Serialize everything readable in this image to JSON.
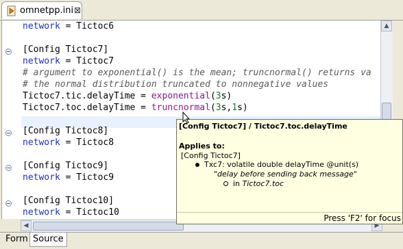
{
  "tab": {
    "filename": "omnetpp.ini",
    "close_glyph": "⊠",
    "icon": "ini-file-icon"
  },
  "editor": {
    "lines": [
      {
        "parts": [
          {
            "t": "network",
            "c": "kw"
          },
          {
            "t": " = Tictoc6",
            "c": ""
          }
        ]
      },
      {
        "parts": [
          {
            "t": "[Config Tictoc7]",
            "c": ""
          }
        ]
      },
      {
        "parts": [
          {
            "t": "network",
            "c": "kw"
          },
          {
            "t": " = Tictoc7",
            "c": ""
          }
        ]
      },
      {
        "parts": [
          {
            "t": "# argument to exponential() is the mean; truncnormal() returns va",
            "c": "cm"
          }
        ]
      },
      {
        "parts": [
          {
            "t": "# the normal distribution truncated to nonnegative values",
            "c": "cm"
          }
        ]
      },
      {
        "parts": [
          {
            "t": "Tictoc7.tic.delayTime = ",
            "c": ""
          },
          {
            "t": "exponential",
            "c": "fn"
          },
          {
            "t": "(",
            "c": ""
          },
          {
            "t": "3",
            "c": "num"
          },
          {
            "t": "s)",
            "c": ""
          }
        ]
      },
      {
        "parts": [
          {
            "t": "Tictoc7.toc.delayTime = ",
            "c": ""
          },
          {
            "t": "truncnormal",
            "c": "fn"
          },
          {
            "t": "(",
            "c": ""
          },
          {
            "t": "3",
            "c": "num"
          },
          {
            "t": "s,",
            "c": ""
          },
          {
            "t": "1",
            "c": "num"
          },
          {
            "t": "s)",
            "c": ""
          }
        ]
      },
      {
        "parts": []
      },
      {
        "parts": [
          {
            "t": "[Config Tictoc8]",
            "c": ""
          }
        ]
      },
      {
        "parts": [
          {
            "t": "network",
            "c": "kw"
          },
          {
            "t": " = Tictoc8",
            "c": ""
          }
        ]
      },
      {
        "parts": []
      },
      {
        "parts": [
          {
            "t": "[Config Tictoc9]",
            "c": ""
          }
        ]
      },
      {
        "parts": [
          {
            "t": "network",
            "c": "kw"
          },
          {
            "t": " = Tictoc9",
            "c": ""
          }
        ]
      },
      {
        "parts": []
      },
      {
        "parts": [
          {
            "t": "[Config Tictoc10]",
            "c": ""
          }
        ]
      },
      {
        "parts": [
          {
            "t": "network",
            "c": "kw"
          },
          {
            "t": " = Tictoc10",
            "c": ""
          }
        ]
      }
    ]
  },
  "tooltip": {
    "header": "[Config Tictoc7] / Tictoc7.toc.delayTime",
    "applies_to": "Applies to:",
    "config": "[Config Tictoc7]",
    "param": "Txc7: volatile double delayTime @unit(s)",
    "description": "\"delay before sending back message\"",
    "location_prefix": "in ",
    "location": "Tictoc7.toc",
    "footer": "Press 'F2' for focus"
  },
  "bottom_tabs": {
    "form": "Form",
    "source": "Source"
  },
  "scroll": {
    "up": "▲",
    "down": "▼",
    "left": "◀",
    "right": "▶"
  }
}
